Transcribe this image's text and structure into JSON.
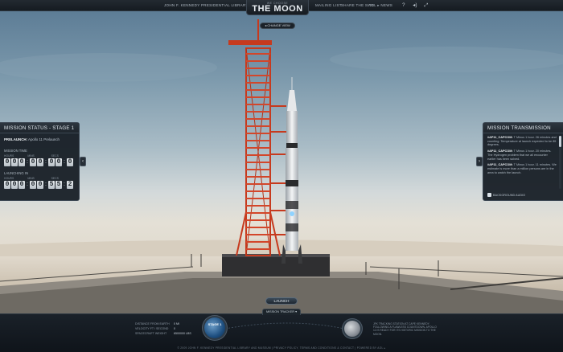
{
  "topbar": {
    "library": "JOHN F. KENNEDY  PRESIDENTIAL LIBRARY & MUSEUM",
    "logo_small": "WE CHOOSE",
    "logo_big": "THE MOON",
    "nav_mailing": "MAILING LIST",
    "nav_share": "SHARE THE SITE",
    "nav_aol": "AOL ▸ News",
    "icons": [
      "help-icon",
      "volume-icon",
      "fullscreen-icon"
    ]
  },
  "scene": {
    "change_view": "◂ CHANGE VIEW"
  },
  "mission_status": {
    "title": "MISSION STATUS - STAGE 1",
    "phase_label": "PRELAUNCH:",
    "phase_value": "Apollo 11 Prelaunch",
    "mission_time_label": "MISSION TIME",
    "launching_label": "LAUNCHING IN",
    "units": [
      "HOURS",
      "MINS",
      "SECS"
    ],
    "mission_time": [
      "0",
      "0",
      "0",
      "0",
      "0",
      "0",
      "0",
      "0"
    ],
    "launching_in": [
      "0",
      "0",
      "0",
      "0",
      "0",
      "5",
      "5",
      "2"
    ]
  },
  "transmission": {
    "title": "MISSION TRANSMISSION",
    "messages": [
      {
        "from": "#AP11_CAPCOM:",
        "text": "T Minus 1 hour. 26 minutes and counting. Temperature at launch expected to be 85 degrees."
      },
      {
        "from": "#AP11_CAPCOM:",
        "text": "T Minus 1 hour. 20 minutes. The Hydrogen problem that we all encounter earlier has been solved."
      },
      {
        "from": "#AP11_CAPCOM:",
        "text": "T Minus 1 hour. 11 minutes. We estimate is more than a million persons are in the area to watch the launch."
      }
    ],
    "audio_label": "BACKGROUND AUDIO"
  },
  "controls": {
    "launch": "LAUNCH",
    "tracker": "MISSION TRACKER ▾"
  },
  "tracker": {
    "stats": [
      {
        "label": "DISTANCE FROM EARTH",
        "value": "0 MI"
      },
      {
        "label": "VELOCITY FT / SECOND",
        "value": "0"
      },
      {
        "label": "SPACECRAFT WEIGHT",
        "value": "6500000 LBS"
      }
    ],
    "earth_label": "STAGE 1",
    "moon_text": "JFK TRACKING STATION AT CAPE KENNEDY. FOLLOWING A FLAWLESS COUNTDOWN, APOLLO 11 IS READY FOR ITS HISTORIC MISSION TO THE MOON."
  },
  "footer": {
    "text": "© 2009 JOHN F. KENNEDY PRESIDENTIAL LIBRARY AND MUSEUM   |   PRIVACY POLICY, TERMS AND CONDITIONS & CONTACT   |   POWERED BY AOL ▸"
  }
}
